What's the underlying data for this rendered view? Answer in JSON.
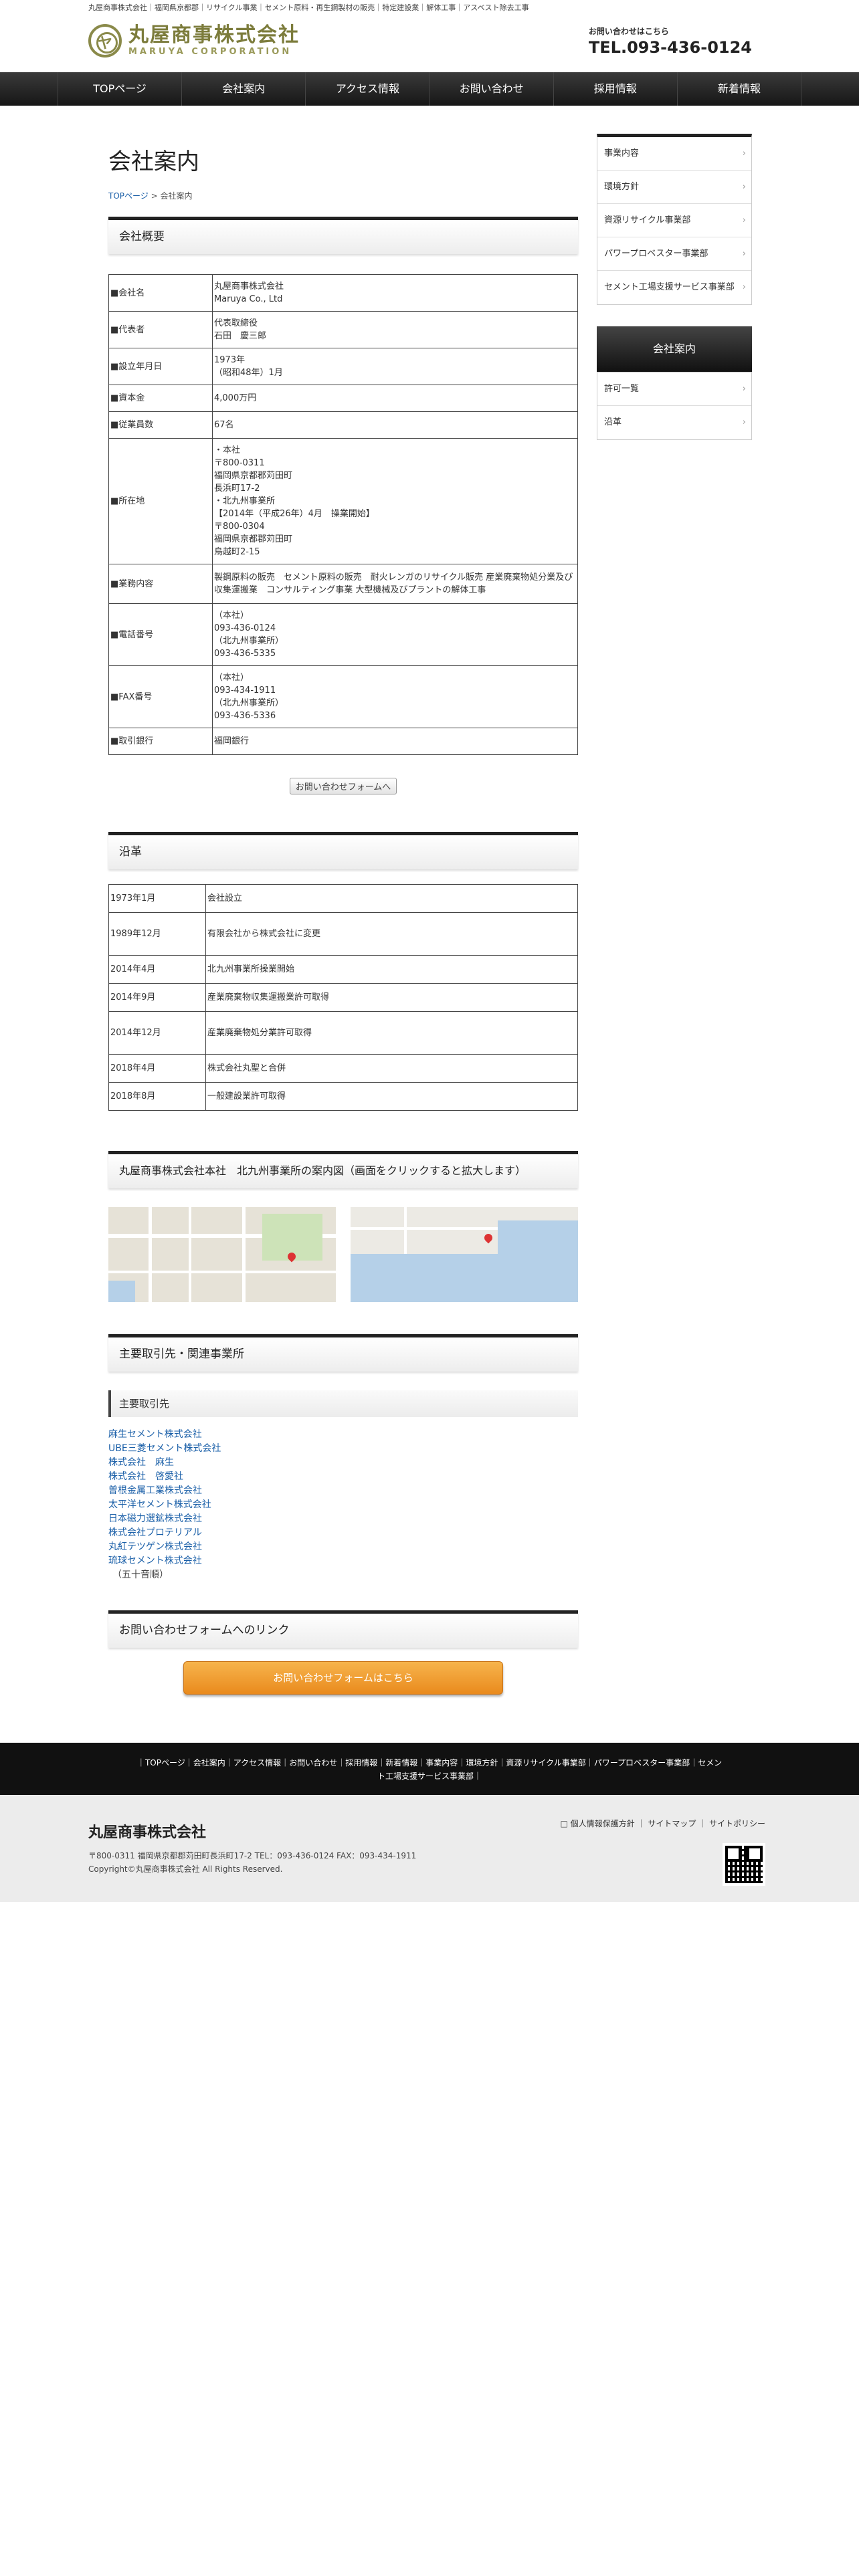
{
  "topline": "丸屋商事株式会社｜福岡県京都郡｜リサイクル事業｜セメント原料・再生鋼製材の販売｜特定建設業｜解体工事｜アスベスト除去工事",
  "logo": {
    "mark": "ヤ",
    "jp": "丸屋商事株式会社",
    "en": "MARUYA CORPORATION"
  },
  "contact": {
    "label": "お問い合わせはこちら",
    "tel": "TEL.093-436-0124"
  },
  "gnav": [
    "TOPページ",
    "会社案内",
    "アクセス情報",
    "お問い合わせ",
    "採用情報",
    "新着情報"
  ],
  "page_title": "会社案内",
  "breadcrumb": {
    "home": "TOPページ",
    "sep": " > ",
    "current": "会社案内"
  },
  "sections": {
    "overview": "会社概要",
    "history": "沿革",
    "map": "丸屋商事株式会社本社　北九州事業所の案内図（画面をクリックすると拡大します）",
    "partners": "主要取引先・関連事業所",
    "partners_sub": "主要取引先",
    "contact_link": "お問い合わせフォームへのリンク"
  },
  "company": [
    {
      "k": "■会社名",
      "v": [
        "丸屋商事株式会社",
        "Maruya Co., Ltd"
      ]
    },
    {
      "k": "■代表者",
      "v": [
        "代表取締役",
        "石田　慶三郎"
      ]
    },
    {
      "k": "■設立年月日",
      "v": [
        "1973年",
        "（昭和48年）1月"
      ]
    },
    {
      "k": "■資本金",
      "v": [
        "4,000万円"
      ]
    },
    {
      "k": "■従業員数",
      "v": [
        "67名"
      ]
    },
    {
      "k": "■所在地",
      "v": [
        "・本社",
        "〒800-0311",
        "福岡県京都郡苅田町",
        "長浜町17-2",
        "・北九州事業所",
        "【2014年（平成26年）4月　操業開始】",
        "〒800-0304",
        "福岡県京都郡苅田町",
        "鳥越町2-15"
      ]
    },
    {
      "k": "■業務内容",
      "v": [
        "製鋼原料の販売　セメント原料の販売　耐火レンガのリサイクル販売 産業廃棄物処分業及び収集運搬業　コンサルティング事業 大型機械及びプラントの解体工事"
      ]
    },
    {
      "k": "■電話番号",
      "v": [
        "（本社）",
        "093-436-0124",
        "（北九州事業所）",
        "093-436-5335"
      ]
    },
    {
      "k": "■FAX番号",
      "v": [
        "（本社）",
        "093-434-1911",
        "（北九州事業所）",
        "093-436-5336"
      ]
    },
    {
      "k": "■取引銀行",
      "v": [
        "福岡銀行"
      ]
    }
  ],
  "inquiry_small": "お問い合わせフォームへ",
  "history": [
    {
      "d": "1973年1月",
      "t": "会社設立"
    },
    {
      "d": "1989年12月",
      "t": "有限会社から株式会社に変更"
    },
    {
      "d": "2014年4月",
      "t": "北九州事業所操業開始"
    },
    {
      "d": "2014年9月",
      "t": "産業廃棄物収集運搬業許可取得"
    },
    {
      "d": "2014年12月",
      "t": "産業廃棄物処分業許可取得"
    },
    {
      "d": "2018年4月",
      "t": "株式会社丸聖と合併"
    },
    {
      "d": "2018年8月",
      "t": "一般建設業許可取得"
    }
  ],
  "partners": [
    "麻生セメント株式会社",
    "UBE三菱セメント株式会社",
    "株式会社　麻生",
    "株式会社　啓愛社",
    "曽根金属工業株式会社",
    "太平洋セメント株式会社",
    "日本磁力選鉱株式会社",
    "株式会社プロテリアル",
    "丸紅テツゲン株式会社",
    "琉球セメント株式会社"
  ],
  "partners_note": "（五十音順）",
  "big_button": "お問い合わせフォームはこちら",
  "side": {
    "items": [
      "事業内容",
      "環境方針",
      "資源リサイクル事業部",
      "パワープロベスター事業部",
      "セメント工場支援サービス事業部"
    ],
    "head": "会社案内",
    "sub": [
      "許可一覧",
      "沿革"
    ]
  },
  "fnav": [
    "TOPページ",
    "会社案内",
    "アクセス情報",
    "お問い合わせ",
    "採用情報",
    "新着情報",
    "事業内容",
    "環境方針",
    "資源リサイクル事業部",
    "パワープロベスター事業部",
    "セメント工場支援サービス事業部"
  ],
  "footer": {
    "company": "丸屋商事株式会社",
    "address": "〒800-0311 福岡県京都郡苅田町長浜町17-2 TEL：093-436-0124  FAX：093-434-1911",
    "copyright": "Copyright©丸屋商事株式会社 All Rights Reserved.",
    "links": [
      "個人情報保護方針",
      "サイトマップ",
      "サイトポリシー"
    ]
  }
}
